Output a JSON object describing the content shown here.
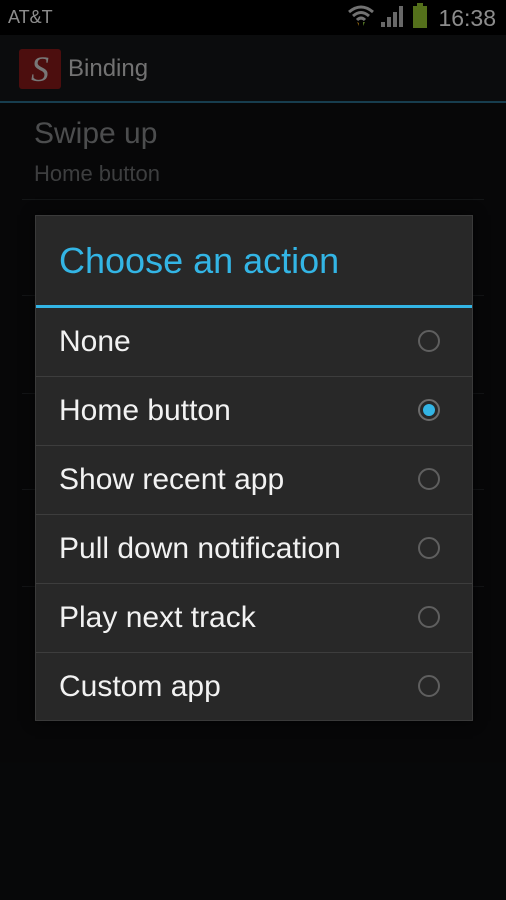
{
  "status_bar": {
    "carrier": "AT&T",
    "time": "16:38",
    "icons": [
      "wifi-icon",
      "signal-icon",
      "battery-icon"
    ]
  },
  "action_bar": {
    "app_icon_letter": "S",
    "title": "Binding"
  },
  "background_list": {
    "item_title": "Swipe up",
    "item_subtitle": "Home button"
  },
  "dialog": {
    "title": "Choose an action",
    "options": [
      {
        "label": "None",
        "selected": false
      },
      {
        "label": "Home button",
        "selected": true
      },
      {
        "label": "Show recent app",
        "selected": false
      },
      {
        "label": "Pull down notification",
        "selected": false
      },
      {
        "label": "Play next track",
        "selected": false
      },
      {
        "label": "Custom app",
        "selected": false
      }
    ]
  },
  "colors": {
    "accent": "#33b5e5",
    "app_icon_bg": "#8b1a1a",
    "dialog_bg": "#282828"
  }
}
